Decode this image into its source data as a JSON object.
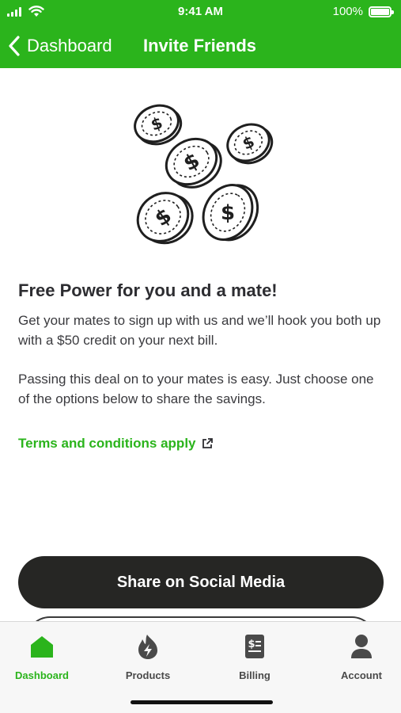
{
  "status_bar": {
    "time": "9:41 AM",
    "battery": "100%"
  },
  "nav": {
    "back_label": "Dashboard",
    "title": "Invite Friends"
  },
  "content": {
    "headline": "Free Power for you and a mate!",
    "paragraph1": "Get your mates to sign up with us and we’ll hook you both up with a $50 credit on your next bill.",
    "paragraph2": "Passing this deal on to your mates is easy. Just choose one of the options below to share the savings.",
    "terms_link": "Terms and conditions apply"
  },
  "actions": {
    "share_social": "Share on Social Media"
  },
  "tabbar": {
    "items": [
      {
        "label": "Dashboard",
        "icon": "home-icon",
        "active": true
      },
      {
        "label": "Products",
        "icon": "flame-bolt-icon",
        "active": false
      },
      {
        "label": "Billing",
        "icon": "bill-icon",
        "active": false
      },
      {
        "label": "Account",
        "icon": "person-icon",
        "active": false
      }
    ]
  },
  "colors": {
    "brand_green": "#2bb41c",
    "button_dark": "#262624",
    "text": "#2d2d31"
  }
}
